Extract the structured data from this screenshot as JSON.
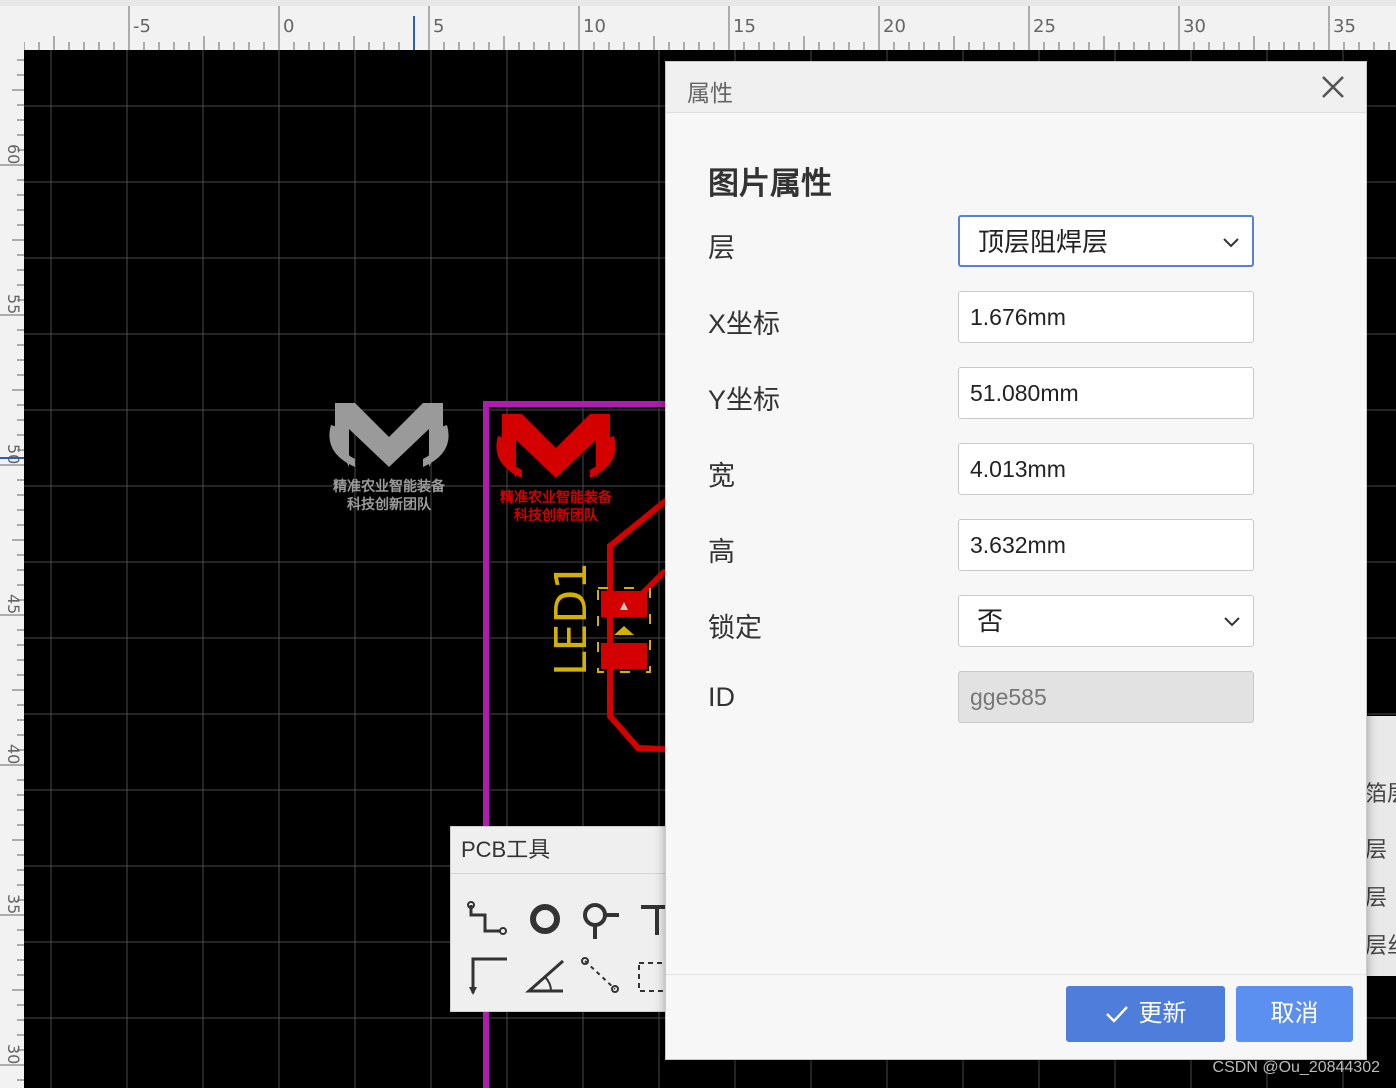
{
  "ruler": {
    "h_labels": [
      "-5",
      "0",
      "5",
      "10",
      "15",
      "20",
      "25",
      "30",
      "35"
    ],
    "v_labels": [
      "60",
      "55",
      "50",
      "45",
      "40",
      "35",
      "30"
    ]
  },
  "pcb": {
    "logo_line1": "精准农业智能装备",
    "logo_line2": "科技创新团队",
    "designator": "LED1",
    "colors": {
      "outline": "#b01cb0",
      "track": "#d40000",
      "silk": "#d4b000",
      "logo_gray": "#9a9a9a"
    }
  },
  "pcb_tools": {
    "title": "PCB工具",
    "tools": [
      "track-icon",
      "via-icon",
      "pad-icon",
      "text-icon",
      "angle-line-icon",
      "arc-icon",
      "connect-icon",
      "rect-icon"
    ]
  },
  "layers_peek": [
    "箔层",
    "层",
    "层",
    "层丝"
  ],
  "dialog": {
    "title": "属性",
    "section": "图片属性",
    "properties": [
      {
        "label": "层",
        "value": "顶层阻焊层",
        "kind": "select",
        "active": true
      },
      {
        "label": "X坐标",
        "value": "1.676mm",
        "kind": "input"
      },
      {
        "label": "Y坐标",
        "value": "51.080mm",
        "kind": "input"
      },
      {
        "label": "宽",
        "value": "4.013mm",
        "kind": "input"
      },
      {
        "label": "高",
        "value": "3.632mm",
        "kind": "input"
      },
      {
        "label": "锁定",
        "value": "否",
        "kind": "select"
      },
      {
        "label": "ID",
        "value": "gge585",
        "kind": "disabled"
      }
    ],
    "update_label": "更新",
    "cancel_label": "取消",
    "accent": "#4f7ddb"
  },
  "watermark": "CSDN @Ou_20844302"
}
